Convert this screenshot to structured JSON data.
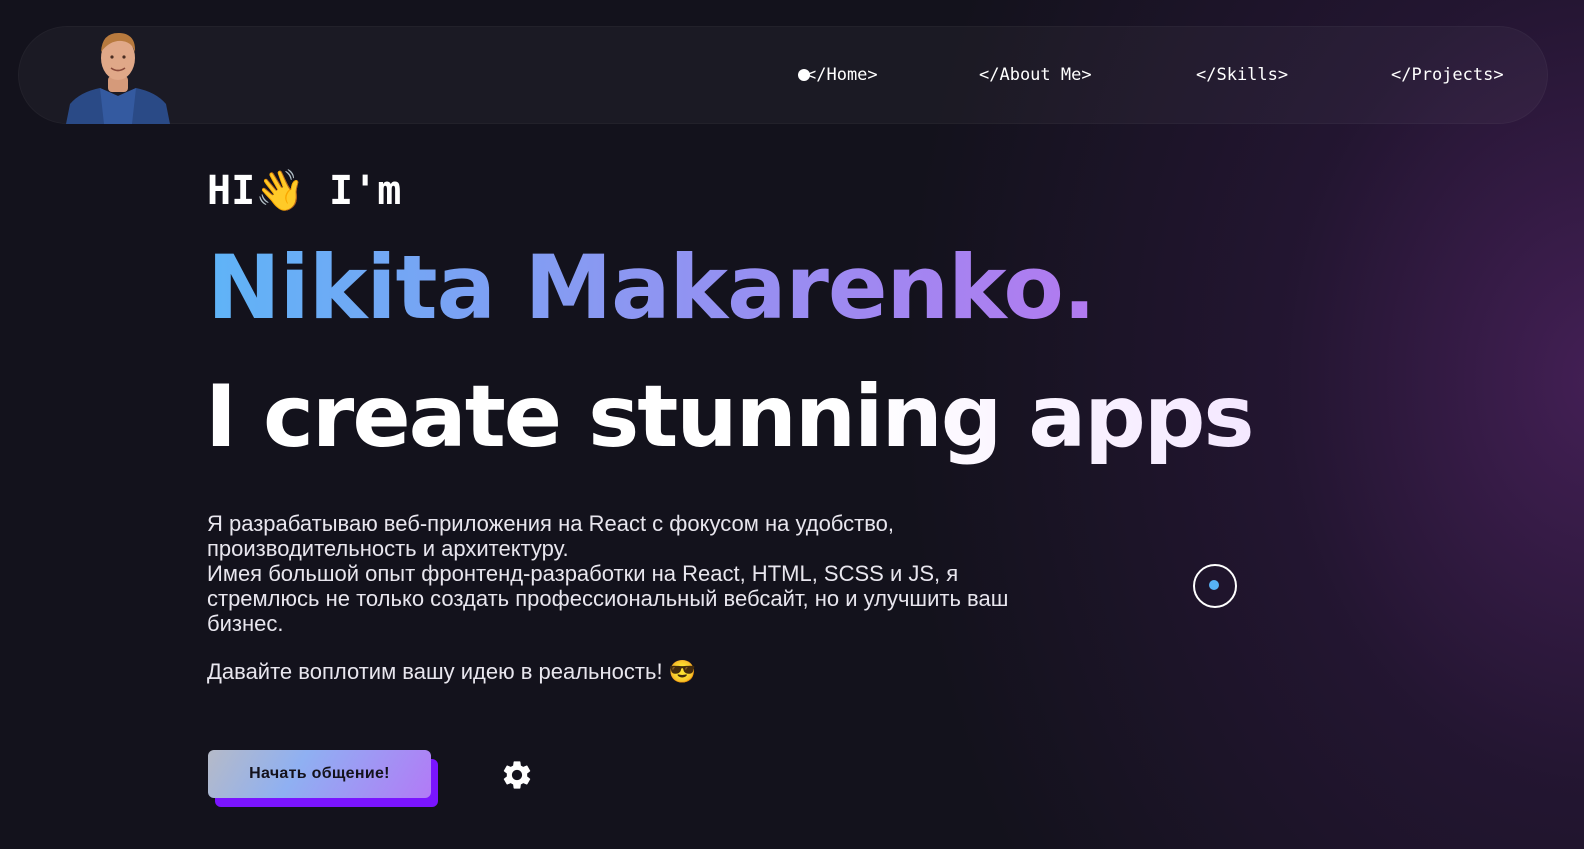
{
  "nav": {
    "items": [
      {
        "label": "</Home>"
      },
      {
        "label": "</About Me>"
      },
      {
        "label": "</Skills>"
      },
      {
        "label": "</Projects>"
      }
    ],
    "active_index": 0
  },
  "hero": {
    "greeting": "HI👋 I'm",
    "name": "Nikita Makarenko.",
    "tagline": "I create stunning apps",
    "description_lines": [
      "Я разрабатываю веб-приложения на React с фокусом на удобство, производительность и архитектуру.",
      "Имея большой опыт фронтенд-разработки на React, HTML, SCSS и JS, я стремлюсь не только создать профессиональный вебсайт, но и улучшить ваш бизнес."
    ],
    "cta_text": "Давайте воплотим вашу идею в реальность! 😎",
    "button_label": "Начать общение!"
  },
  "icons": {
    "settings": "gear-icon",
    "avatar": "avatar"
  },
  "colors": {
    "background": "#13121c",
    "accent_blue": "#5fb4f7",
    "accent_purple": "#b27af0",
    "button_shadow": "#7a14ff"
  }
}
